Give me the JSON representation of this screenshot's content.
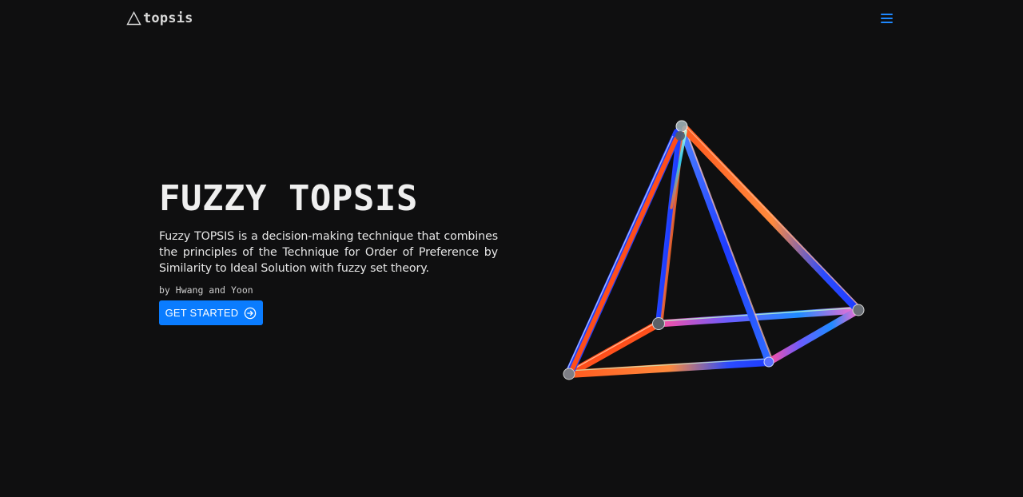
{
  "nav": {
    "brand_name": "topsis",
    "brand_icon": "triangle-outline-icon",
    "menu_icon": "hamburger-menu-icon"
  },
  "hero": {
    "title": "FUZZY TOPSIS",
    "description": "Fuzzy TOPSIS is a decision-making technique that combines the principles of the Technique for Order of Preference by Similarity to Ideal Solution with fuzzy set theory.",
    "author": "by Hwang and Yoon",
    "cta_label": "GET STARTED",
    "cta_icon": "arrow-right-circle-icon"
  },
  "illustration": {
    "name": "iridescent-glass-pyramid",
    "colors": [
      "#ff5a1f",
      "#1f5bff",
      "#00d2ff",
      "#ff3fa4",
      "#a8ffdc"
    ]
  },
  "colors": {
    "background": "#0f0f10",
    "accent": "#0a7cff",
    "text": "#efefef"
  }
}
